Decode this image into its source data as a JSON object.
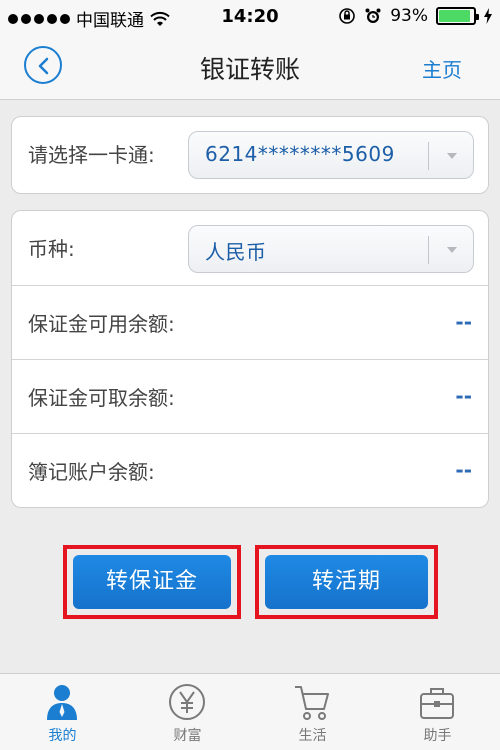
{
  "status_bar": {
    "carrier": "中国联通",
    "time": "14:20",
    "battery_percent": "93%",
    "battery_level": 0.93
  },
  "nav": {
    "title": "银证转账",
    "home_label": "主页"
  },
  "card_select": {
    "label": "请选择一卡通:",
    "value": "6214********5609"
  },
  "details": {
    "currency_label": "币种:",
    "currency_value": "人民币",
    "rows": [
      {
        "label": "保证金可用余额:",
        "value": "--"
      },
      {
        "label": "保证金可取余额:",
        "value": "--"
      },
      {
        "label": "簿记账户余额:",
        "value": "--"
      }
    ]
  },
  "actions": {
    "to_margin": "转保证金",
    "to_current": "转活期"
  },
  "tabs": [
    {
      "label": "我的",
      "icon": "person-icon",
      "active": true
    },
    {
      "label": "财富",
      "icon": "yen-icon",
      "active": false
    },
    {
      "label": "生活",
      "icon": "cart-icon",
      "active": false
    },
    {
      "label": "助手",
      "icon": "briefcase-icon",
      "active": false
    }
  ],
  "colors": {
    "accent": "#1b7ed1",
    "button": "#1a7ad6",
    "highlight_border": "#e41420",
    "value_text": "#2e6bb5"
  }
}
